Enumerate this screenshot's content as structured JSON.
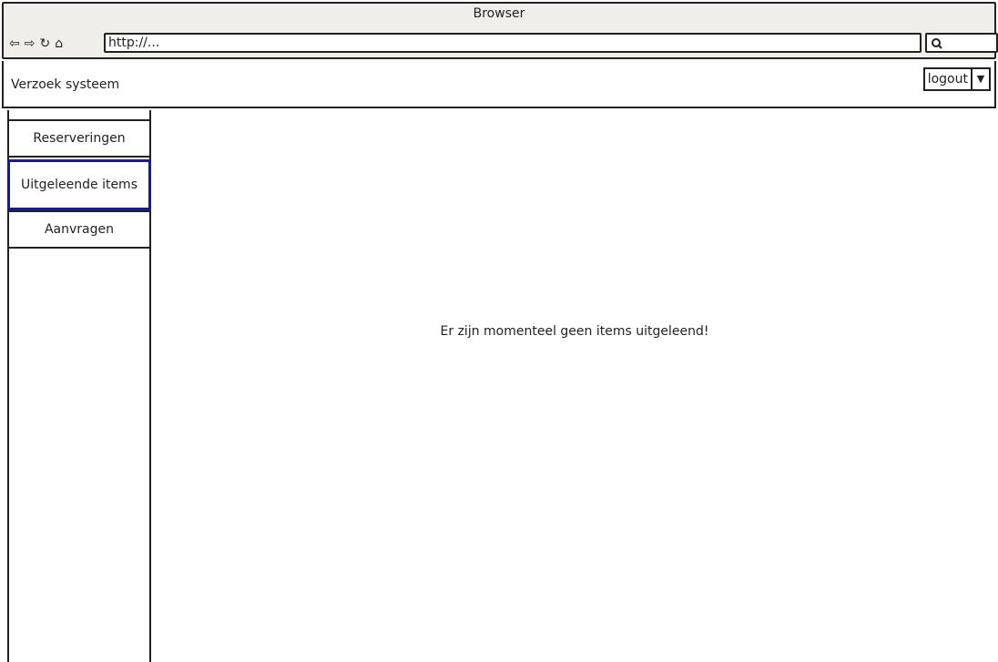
{
  "browser": {
    "title": "Browser",
    "url": "http://...",
    "icons": [
      "back-arrow-icon",
      "forward-arrow-icon",
      "reload-icon",
      "home-icon",
      "search-icon"
    ]
  },
  "header": {
    "app_title": "Verzoek systeem",
    "logout_label": "logout",
    "dropdown_icon": "caret-down-icon"
  },
  "sidebar": {
    "items": [
      {
        "label": "Reserveringen",
        "active": false
      },
      {
        "label": "Uitgeleende items",
        "active": true
      },
      {
        "label": "Aanvragen",
        "active": false
      }
    ]
  },
  "main": {
    "message": "Er zijn momenteel geen items uitgeleend!"
  },
  "colors": {
    "chrome_bg": "#efeeea",
    "active_border": "#1a1a8a",
    "line": "#222222"
  }
}
